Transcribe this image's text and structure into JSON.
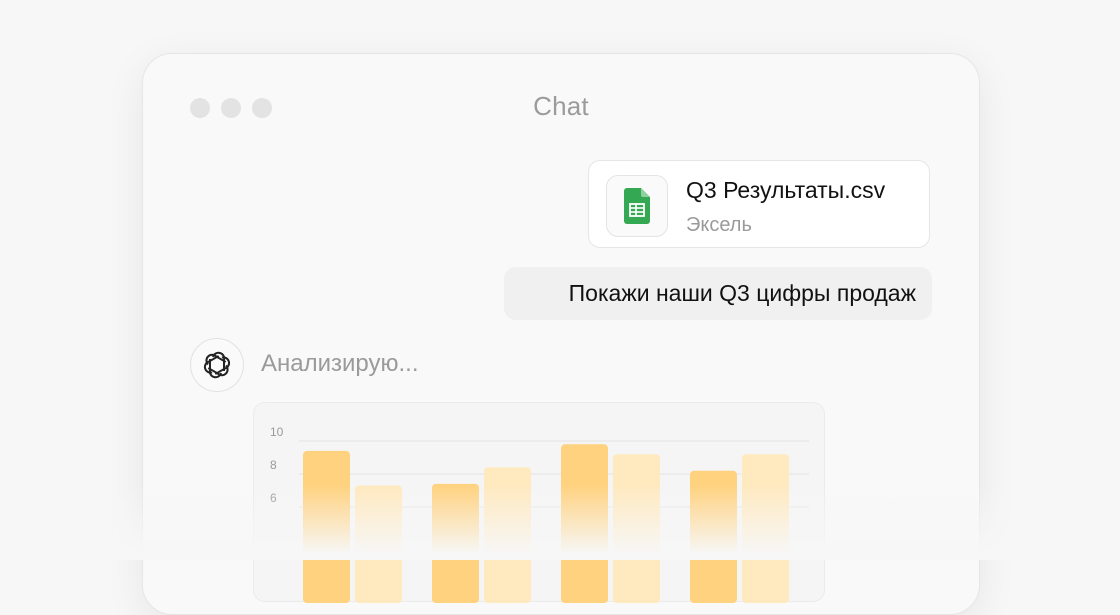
{
  "window": {
    "title": "Chat"
  },
  "attachment": {
    "file_name": "Q3 Результаты.csv",
    "file_type": "Эксель",
    "icon": "spreadsheet-icon",
    "icon_color": "#34a853"
  },
  "messages": {
    "user_text": "Покажи наши Q3 цифры продаж",
    "assistant_status": "Анализирую..."
  },
  "assistant": {
    "icon": "openai-logo-icon"
  },
  "colors": {
    "bar_strong": "#ffd27f",
    "bar_light": "#ffe9bf",
    "window_dot": "#e3e3e3"
  },
  "chart_data": {
    "type": "bar",
    "y_ticks": [
      "10",
      "8",
      "6"
    ],
    "ylim": [
      4,
      10
    ],
    "grid": true,
    "series": [
      {
        "values": [
          9.4,
          7.4,
          9.8,
          8.2
        ]
      },
      {
        "values": [
          7.3,
          8.4,
          9.2,
          9.2
        ]
      }
    ]
  }
}
